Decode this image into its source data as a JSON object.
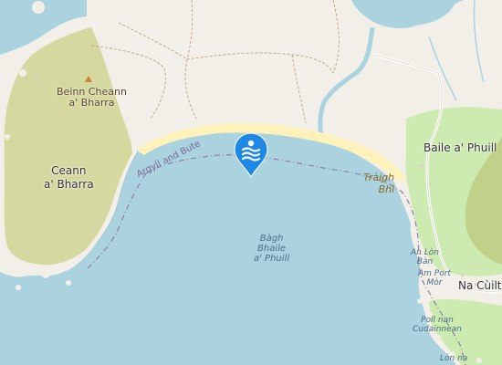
{
  "map": {
    "labels": {
      "peninsula_town": "Ceann\na' Bharra",
      "hill": "Beinn Cheann\na' Bharra",
      "village": "Baile a' Phuill",
      "na_cuiltean": "Na Cùiltean",
      "bay": "Bàgh\nBhaile\na' Phuill",
      "beach": "Tràigh\nBhì",
      "boundary": "Argyll and Bute",
      "an_lon_ban": "An Lòn\nBàn",
      "am_port_mor": "Am Port\nMòr",
      "poll_nan_cudainnean": "Poll nan\nCudainnean",
      "lon_na": "Lòn na"
    },
    "marker": {
      "icon": "swimming-icon",
      "color": "#1e88e5"
    },
    "colors": {
      "water": "#aad3df",
      "land": "#f2efe9",
      "beach": "#fff1ba",
      "heath": "#d6d99f",
      "grass": "#cdebb0",
      "boundary": "#8d7fa6"
    }
  }
}
